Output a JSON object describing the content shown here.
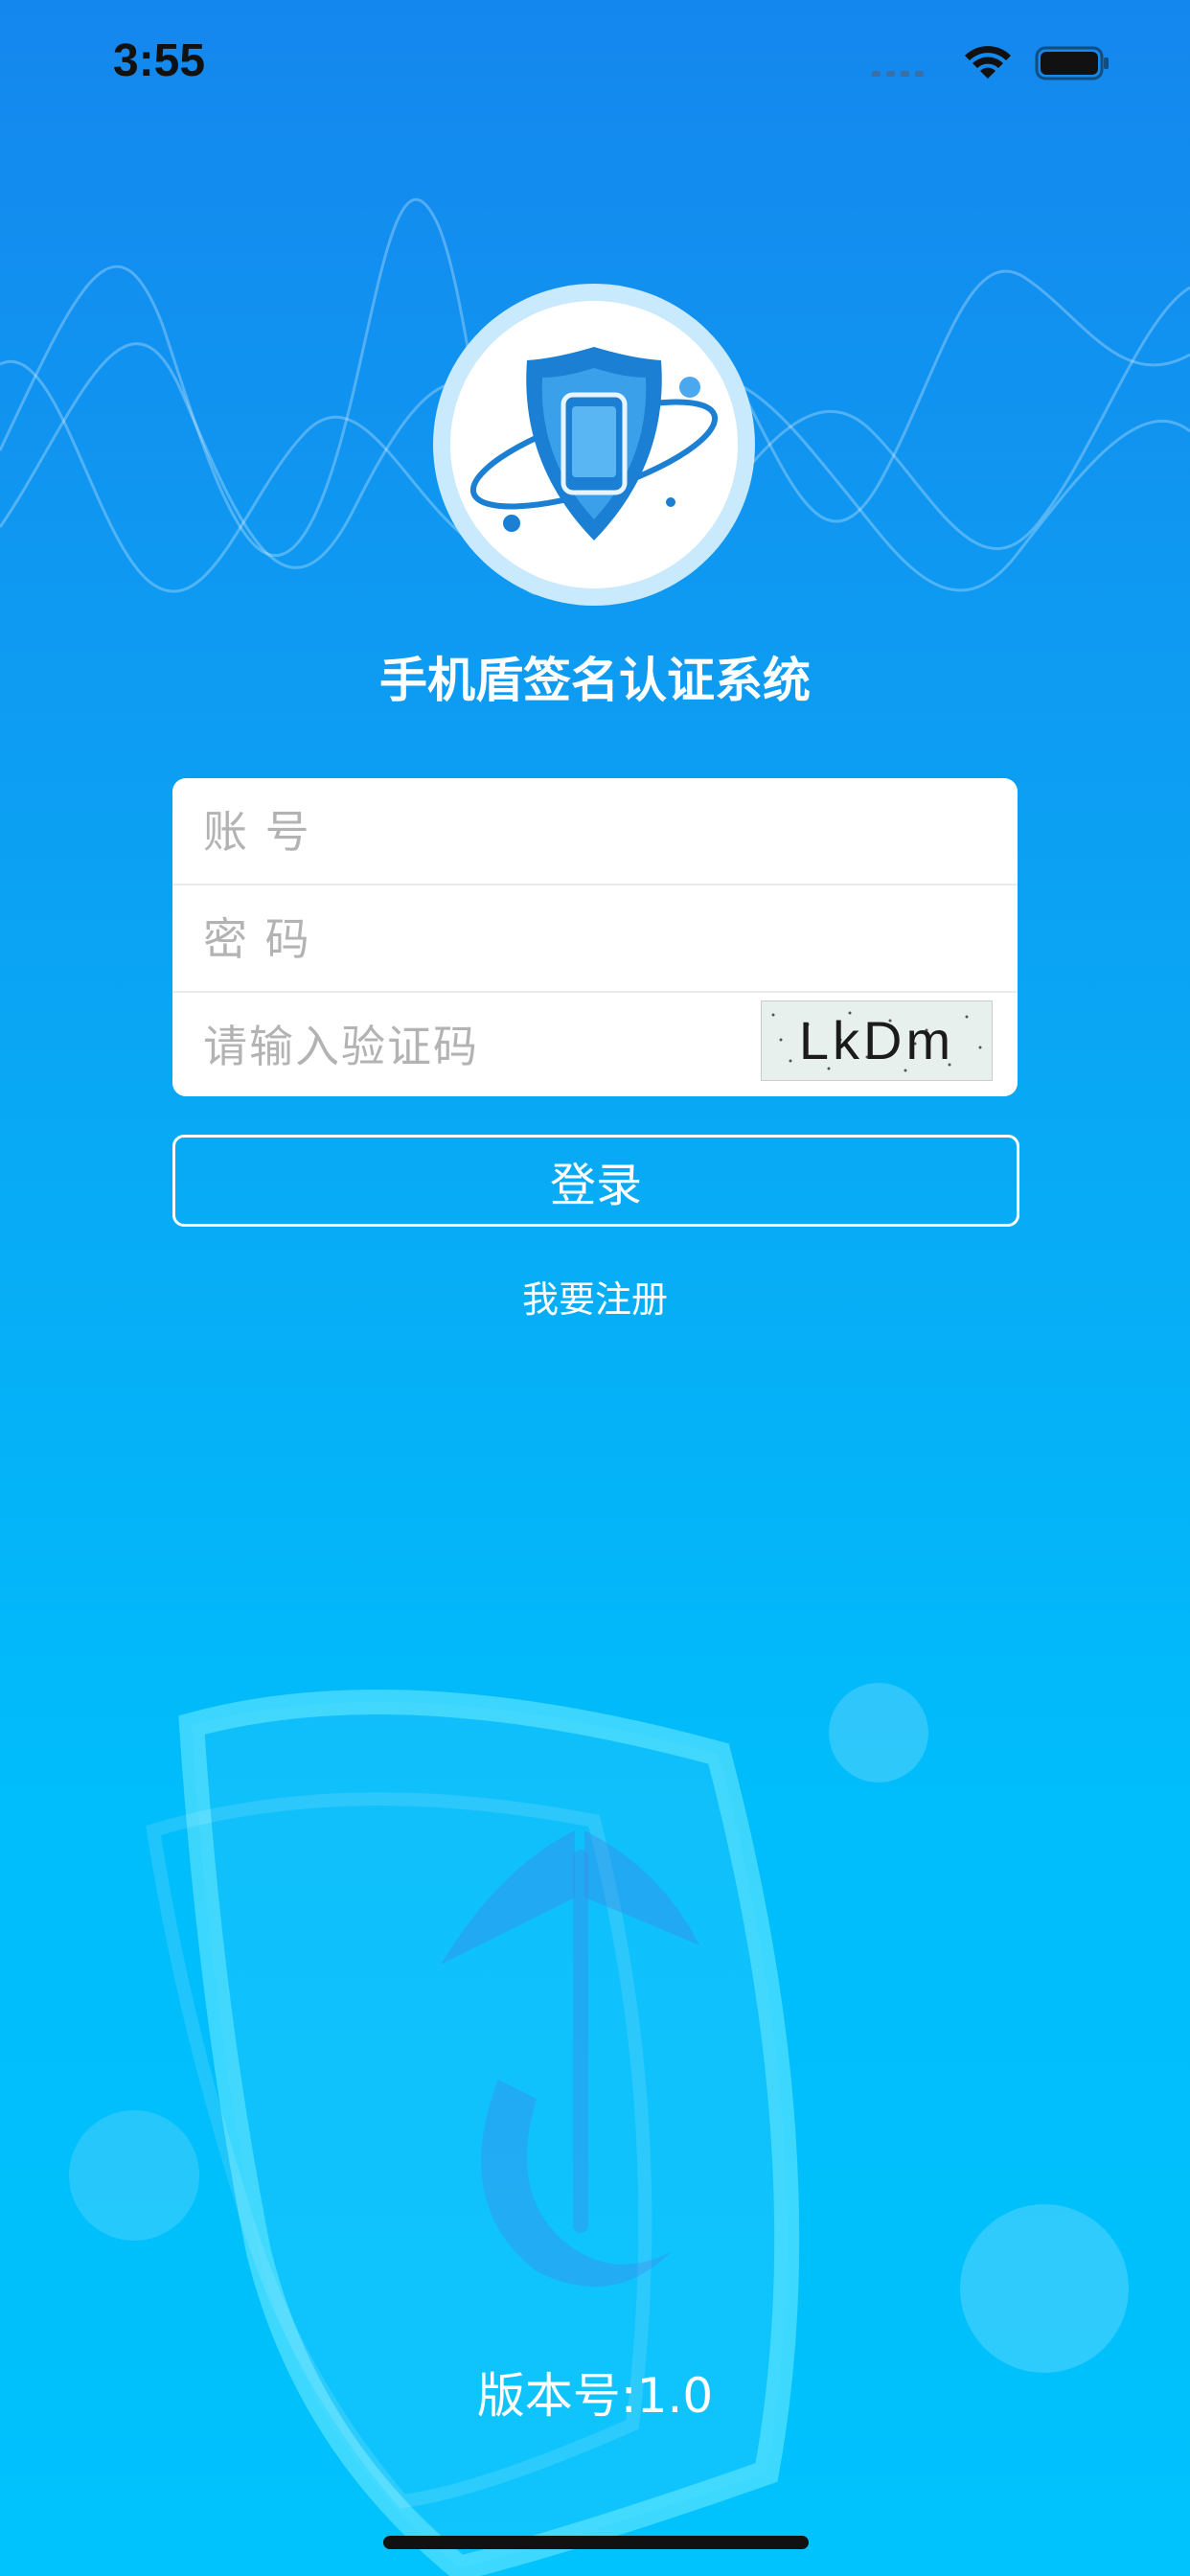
{
  "status_bar": {
    "time": "3:55",
    "icons": [
      "signal-icon",
      "wifi-icon",
      "battery-icon"
    ]
  },
  "app": {
    "logo_icon": "shield-phone-icon",
    "title": "手机盾签名认证系统"
  },
  "form": {
    "account_placeholder": "账 号",
    "password_placeholder": "密 码",
    "captcha_placeholder": "请输入验证码",
    "captcha_text": "LkDm"
  },
  "actions": {
    "login_label": "登录",
    "register_label": "我要注册"
  },
  "footer": {
    "version": "版本号:1.0"
  },
  "colors": {
    "background_top": "#1487ee",
    "background_bottom": "#00c2fd",
    "logo_blue": "#1b7fd4",
    "card": "#ffffff"
  }
}
